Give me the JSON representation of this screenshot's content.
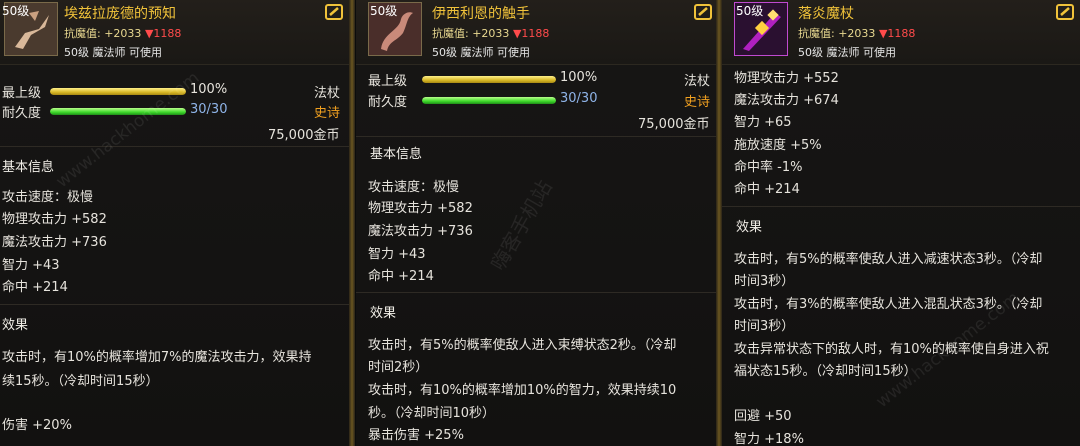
{
  "cards": [
    {
      "level_badge": "50级",
      "name": "埃兹拉庞德的预知",
      "resist_label": "抗魔值:",
      "resist_up": "+2033",
      "resist_down": "▼1188",
      "requirement": "50级 魔法师 可使用",
      "grade_label": "最上级",
      "grade_pct": "100%",
      "grade_fraction": 1.0,
      "type": "法杖",
      "durability_label": "耐久度",
      "durability": "30/30",
      "durability_fraction": 1.0,
      "rarity": "史诗",
      "price": "75,000金币",
      "basic_info_title": "基本信息",
      "stats": [
        "攻击速度：极慢",
        "物理攻击力 +582",
        "魔法攻击力 +736",
        "智力 +43",
        "命中 +214"
      ],
      "effect_title": "效果",
      "effects": [
        "攻击时，有10%的概率增加7%的魔法攻击力，效果持",
        "续15秒。（冷却时间15秒）"
      ],
      "bonus": [
        "伤害 +20%"
      ]
    },
    {
      "level_badge": "50级",
      "name": "伊西利恩的触手",
      "resist_label": "抗魔值:",
      "resist_up": "+2033",
      "resist_down": "▼1188",
      "requirement": "50级 魔法师 可使用",
      "grade_label": "最上级",
      "grade_pct": "100%",
      "grade_fraction": 1.0,
      "type": "法杖",
      "durability_label": "耐久度",
      "durability": "30/30",
      "durability_fraction": 1.0,
      "rarity": "史诗",
      "price": "75,000金币",
      "basic_info_title": "基本信息",
      "stats": [
        "攻击速度：极慢",
        "物理攻击力 +582",
        "魔法攻击力 +736",
        "智力 +43",
        "命中 +214"
      ],
      "effect_title": "效果",
      "effects": [
        "攻击时，有5%的概率使敌人进入束缚状态2秒。（冷却",
        "时间2秒）",
        "攻击时，有10%的概率增加10%的智力，效果持续10",
        "秒。（冷却时间10秒）"
      ],
      "bonus": [
        "暴击伤害 +25%"
      ]
    },
    {
      "level_badge": "50级",
      "name": "落炎魔杖",
      "resist_label": "抗魔值:",
      "resist_up": "+2033",
      "resist_down": "▼1188",
      "requirement": "50级 魔法师 可使用",
      "stats": [
        "物理攻击力 +552",
        "魔法攻击力 +674",
        "智力 +65",
        "施放速度 +5%",
        "命中率 -1%",
        "命中 +214"
      ],
      "effect_title": "效果",
      "effects": [
        "攻击时，有5%的概率使敌人进入减速状态3秒。（冷却",
        "时间3秒）",
        "攻击时，有3%的概率使敌人进入混乱状态3秒。（冷却",
        "时间3秒）",
        "攻击异常状态下的敌人时，有10%的概率使自身进入祝",
        "福状态15秒。（冷却时间15秒）"
      ],
      "bonus": [
        "回避 +50",
        "智力 +18%"
      ]
    }
  ],
  "watermarks": [
    "www.hackhome.com",
    "嗨客手机站",
    "www.hackhome.com"
  ],
  "colors": {
    "title_gold": "#f0c23a",
    "rarity_orange": "#f0a020",
    "durability_blue": "#8fb4e8",
    "resist_red": "#ff4b4b",
    "separator_gold": "#6b5620"
  }
}
